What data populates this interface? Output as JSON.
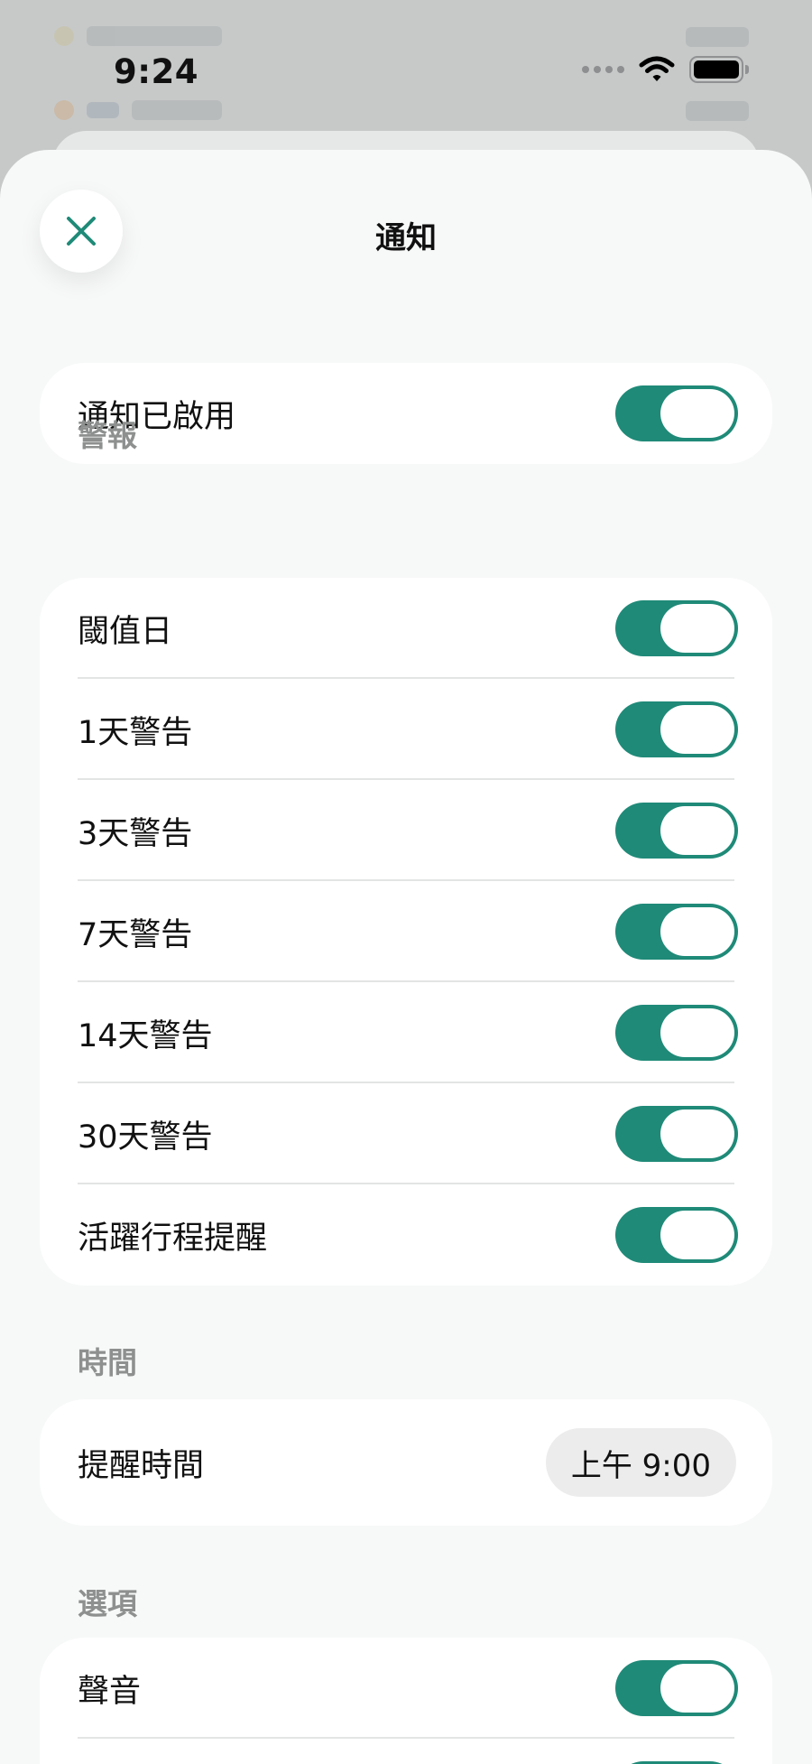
{
  "status_bar": {
    "time": "9:24"
  },
  "sheet": {
    "title": "通知"
  },
  "master": {
    "label": "通知已啟用",
    "enabled": true
  },
  "alerts": {
    "section_label": "警報",
    "items": [
      {
        "label": "閾值日",
        "enabled": true
      },
      {
        "label": "1天警告",
        "enabled": true
      },
      {
        "label": "3天警告",
        "enabled": true
      },
      {
        "label": "7天警告",
        "enabled": true
      },
      {
        "label": "14天警告",
        "enabled": true
      },
      {
        "label": "30天警告",
        "enabled": true
      },
      {
        "label": "活躍行程提醒",
        "enabled": true
      }
    ]
  },
  "time": {
    "section_label": "時間",
    "reminder_label": "提醒時間",
    "reminder_value": "上午 9:00"
  },
  "options": {
    "section_label": "選項",
    "items": [
      {
        "label": "聲音",
        "enabled": true
      }
    ]
  },
  "colors": {
    "accent": "#1f8a78",
    "sheet_bg": "#f7f8f8",
    "card_bg": "#ffffff",
    "section_label": "#8e9090"
  },
  "icons": {
    "close": "close-icon",
    "wifi": "wifi-icon",
    "battery": "battery-icon"
  }
}
